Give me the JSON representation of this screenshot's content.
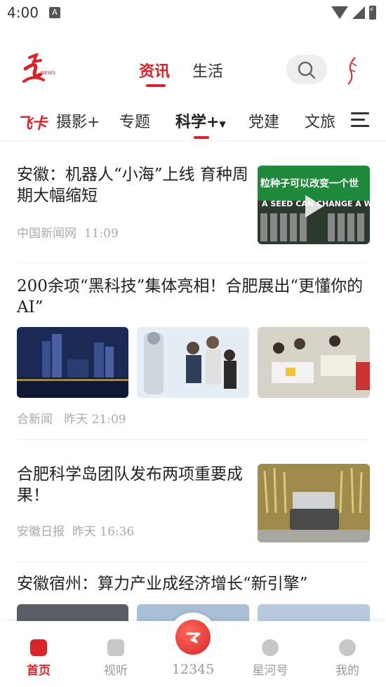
{
  "status": {
    "time": "4:00",
    "notification": "A"
  },
  "header": {
    "tabs": [
      "资讯",
      "生活"
    ],
    "active_tab": 0
  },
  "channels": {
    "special": "飞卡",
    "items": [
      "摄影+",
      "专题",
      "科学+",
      "党建",
      "文旅"
    ],
    "active": "科学+"
  },
  "news": [
    {
      "title": "安徽：机器人“小海”上线 育种周期大幅缩短",
      "source": "中国新闻网",
      "time": "11:09",
      "thumb_text": "粒种子可以改变一个世 A SEED CAN CHANGE A WORLD"
    },
    {
      "title": "200余项“黑科技”集体亮相！合肥展出“更懂你的AI”",
      "source": "合新闻",
      "time": "昨天 21:09"
    },
    {
      "title": "合肥科学岛团队发布两项重要成果！",
      "source": "安徽日报",
      "time": "昨天 16:36"
    },
    {
      "title": "安徽宿州：算力产业成经济增长“新引擎”"
    }
  ],
  "bottom_nav": [
    {
      "label": "首页",
      "icon": "home-icon"
    },
    {
      "label": "视听",
      "icon": "play-icon"
    },
    {
      "label": "12345",
      "icon": "hotline-icon"
    },
    {
      "label": "星河号",
      "icon": "chat-icon"
    },
    {
      "label": "我的",
      "icon": "profile-icon"
    }
  ],
  "colors": {
    "accent": "#d7262b",
    "text": "#222222",
    "meta": "#aaaaaa"
  }
}
